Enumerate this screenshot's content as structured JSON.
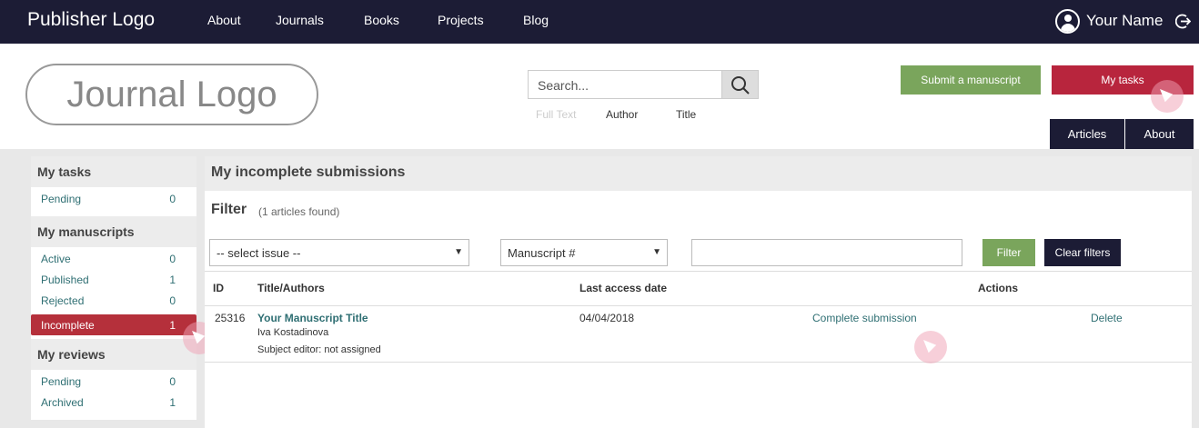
{
  "topbar": {
    "publisher_logo": "Publisher Logo",
    "nav": [
      "About",
      "Journals",
      "Books",
      "Projects",
      "Blog"
    ],
    "user_name": "Your Name",
    "icons": {
      "user": "user-icon",
      "logout": "logout-icon"
    }
  },
  "header": {
    "journal_logo": "Journal Logo",
    "search": {
      "placeholder": "Search...",
      "icon": "search-icon"
    },
    "search_types": [
      "Full Text",
      "Author",
      "Title"
    ],
    "submit_button": "Submit a manuscript",
    "tasks_button": "My tasks",
    "tabs": [
      "Articles",
      "About"
    ]
  },
  "sidebar": {
    "sections": [
      {
        "title": "My tasks",
        "items": [
          {
            "label": "Pending",
            "count": "0"
          }
        ]
      },
      {
        "title": "My manuscripts",
        "items": [
          {
            "label": "Active",
            "count": "0"
          },
          {
            "label": "Published",
            "count": "1"
          },
          {
            "label": "Rejected",
            "count": "0"
          },
          {
            "label": "Incomplete",
            "count": "1",
            "active": true
          }
        ]
      },
      {
        "title": "My reviews",
        "items": [
          {
            "label": "Pending",
            "count": "0"
          },
          {
            "label": "Archived",
            "count": "1"
          }
        ]
      }
    ]
  },
  "main": {
    "title": "My incomplete submissions",
    "filter_title": "Filter",
    "filter_count": "(1 articles found)",
    "issue_select": "-- select issue --",
    "field_select": "Manuscript #",
    "filter_button": "Filter",
    "clear_button": "Clear filters",
    "columns": [
      "ID",
      "Title/Authors",
      "Last access date",
      "Actions"
    ],
    "rows": [
      {
        "id": "25316",
        "title": "Your Manuscript Title",
        "author": "Iva Kostadinova",
        "editor": "Subject editor: not assigned",
        "date": "04/04/2018",
        "action_complete": "Complete submission",
        "action_delete": "Delete"
      }
    ]
  },
  "colors": {
    "nav_bg": "#1c1c35",
    "accent_green": "#7aa55c",
    "accent_red": "#b8253d",
    "link": "#2f6f73"
  }
}
